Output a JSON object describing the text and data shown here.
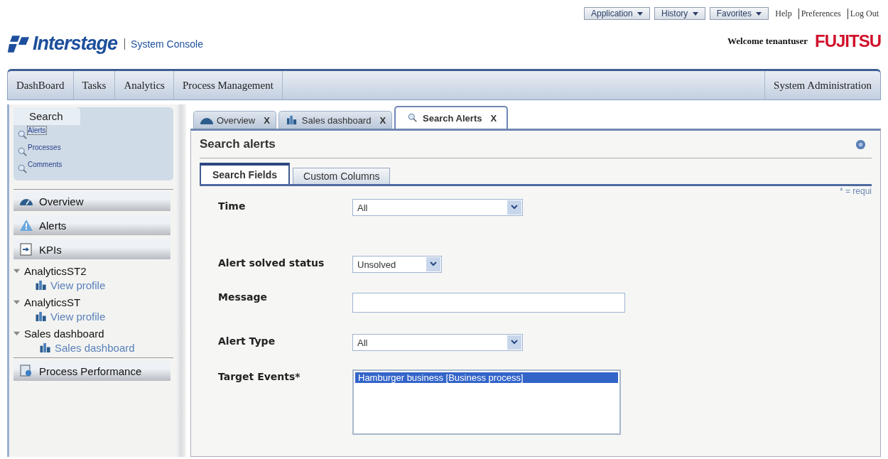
{
  "header": {
    "logo": "Interstage",
    "subtitle": "System Console",
    "menus": [
      {
        "label": "Application",
        "kind": "dropdown"
      },
      {
        "label": "History",
        "kind": "dropdown"
      },
      {
        "label": "Favorites",
        "kind": "dropdown"
      },
      {
        "label": "Help",
        "kind": "link"
      },
      {
        "label": "Preferences",
        "kind": "link"
      },
      {
        "label": "Log Out",
        "kind": "link"
      }
    ],
    "welcome": "Welcome tenantuser",
    "brand": "FUJITSU"
  },
  "nav": {
    "left": [
      {
        "label": "DashBoard",
        "selected": false
      },
      {
        "label": "Tasks",
        "selected": false
      },
      {
        "label": "Analytics",
        "selected": false
      },
      {
        "label": "Process Management",
        "selected": false
      }
    ],
    "right": [
      {
        "label": "System Administration",
        "selected": false
      }
    ]
  },
  "sidebar": {
    "search_tab": "Search",
    "search_links": [
      {
        "label": "Alerts",
        "selected": true
      },
      {
        "label": "Processes",
        "selected": false
      },
      {
        "label": "Comments",
        "selected": false
      }
    ],
    "items": [
      {
        "kind": "bar",
        "label": "Overview"
      },
      {
        "kind": "bar",
        "label": "Alerts"
      },
      {
        "kind": "bar",
        "label": "KPIs"
      },
      {
        "kind": "tree",
        "label": "AnalyticsST2",
        "expanded": true,
        "children": [
          {
            "label": "View profile"
          }
        ]
      },
      {
        "kind": "tree",
        "label": "AnalyticsST",
        "expanded": true,
        "children": [
          {
            "label": "View profile"
          }
        ]
      },
      {
        "kind": "tree",
        "label": "Sales dashboard",
        "expanded": true,
        "children": [
          {
            "label": "Sales dashboard"
          }
        ]
      },
      {
        "kind": "bar",
        "label": "Process Performance"
      }
    ]
  },
  "tabs": [
    {
      "label": "Overview",
      "close": "X",
      "selected": false
    },
    {
      "label": "Sales dashboard",
      "close": "X",
      "selected": false
    },
    {
      "label": "Search Alerts",
      "close": "X",
      "selected": true
    }
  ],
  "panel": {
    "title": "Search alerts",
    "subtabs": [
      {
        "label": "Search Fields",
        "selected": true
      },
      {
        "label": "Custom Columns",
        "selected": false
      }
    ],
    "required_note": "* = requi",
    "fields": [
      {
        "label": "Time",
        "kind": "select",
        "value": "All"
      },
      {
        "label": "Alert solved status",
        "kind": "select",
        "value": "Unsolved"
      },
      {
        "label": "Message",
        "kind": "text"
      },
      {
        "label": "Alert Type",
        "kind": "select",
        "value": "All"
      },
      {
        "label": "Target Events*",
        "kind": "listbox",
        "options": [
          {
            "label": "Hamburger business [Business process]",
            "selected": true
          }
        ]
      }
    ]
  }
}
